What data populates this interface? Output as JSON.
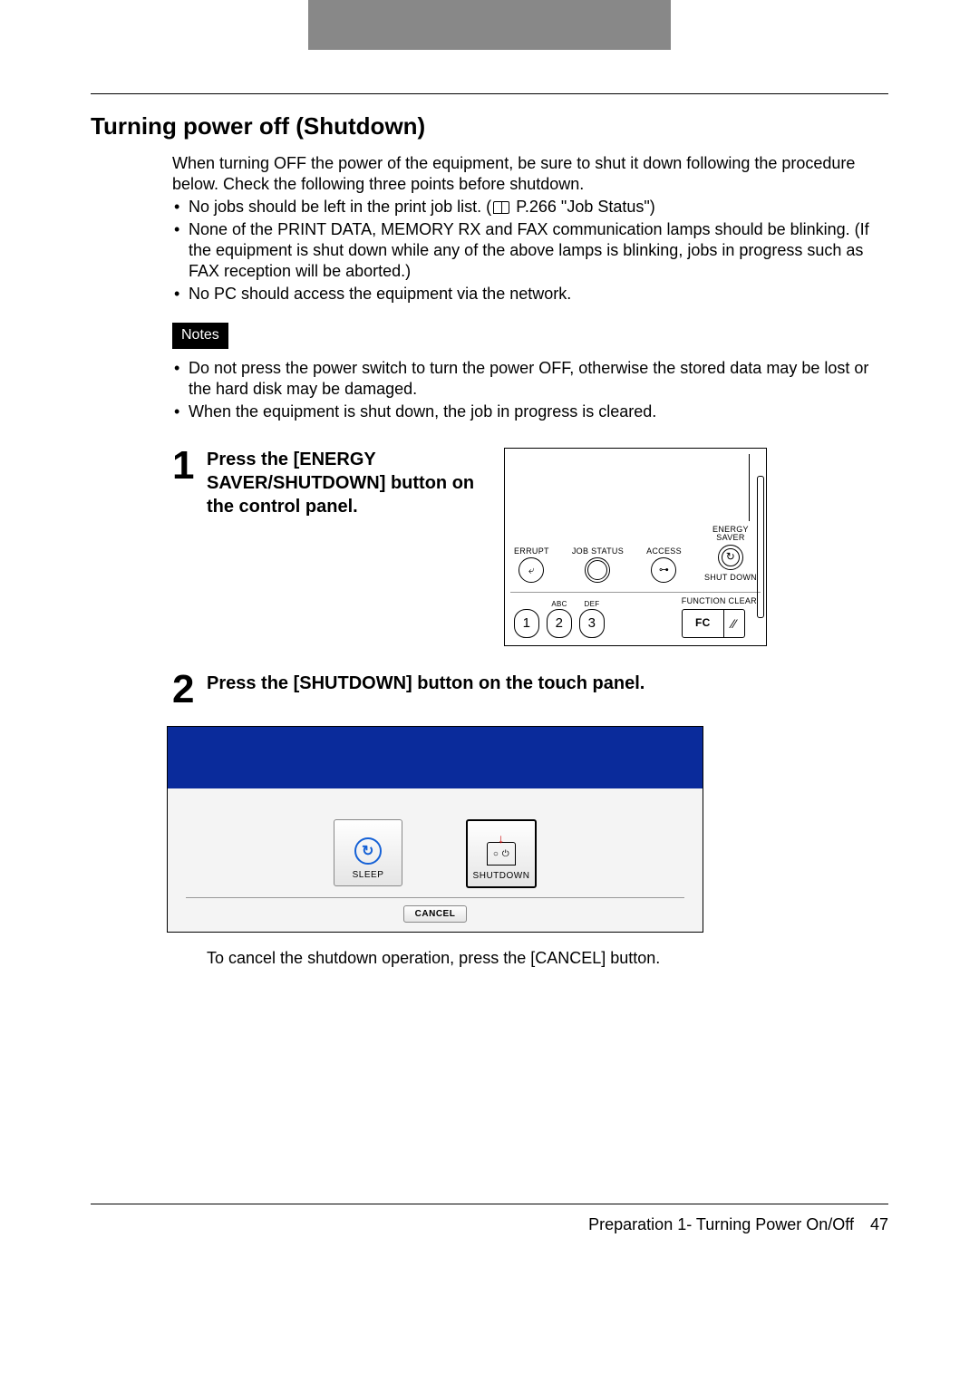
{
  "title": "Turning power off (Shutdown)",
  "intro_p1": "When turning OFF the power of the equipment, be sure to shut it down following the procedure below. Check the following three points before shutdown.",
  "intro_bullets": [
    {
      "pre": "No jobs should be left in the print job list. (",
      "ref": "P.266 \"Job Status\"",
      "post": ")"
    },
    {
      "text": "None of the PRINT DATA, MEMORY RX and FAX communication lamps should be blinking. (If the equipment is shut down while any of the above lamps is blinking, jobs in progress such as FAX reception will be aborted.)"
    },
    {
      "text": "No PC should access the equipment via the network."
    }
  ],
  "notes_label": "Notes",
  "notes_bullets": [
    "Do not press the power switch to turn the power OFF, otherwise the stored data may be lost or the hard disk may be damaged.",
    "When the equipment is shut down, the job in progress is cleared."
  ],
  "step1_num": "1",
  "step1_text": "Press the [ENERGY SAVER/SHUTDOWN] button on the control panel.",
  "panel": {
    "interrupt": "ERRUPT",
    "job_status": "JOB STATUS",
    "access": "ACCESS",
    "energy_saver_line1": "ENERGY",
    "energy_saver_line2": "SAVER",
    "shutdown": "SHUT DOWN",
    "abc": "ABC",
    "def": "DEF",
    "k1": "1",
    "k2": "2",
    "k3": "3",
    "function_clear": "FUNCTION CLEAR",
    "fc": "FC"
  },
  "step2_num": "2",
  "step2_text": "Press the [SHUTDOWN] button on the touch panel.",
  "touch": {
    "sleep": "SLEEP",
    "shutdown": "SHUTDOWN",
    "cancel": "CANCEL"
  },
  "post_text": "To cancel the shutdown operation, press the [CANCEL] button.",
  "footer_section": "Preparation 1- Turning Power On/Off",
  "footer_page": "47"
}
